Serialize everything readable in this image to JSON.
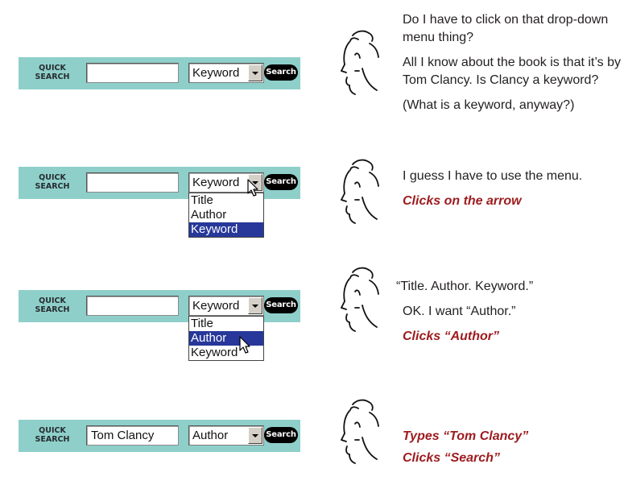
{
  "search_widget": {
    "label_line1": "QUICK",
    "label_line2": "SEARCH",
    "button_label": "Search"
  },
  "panels": [
    {
      "input_value": "",
      "select_value": "Keyword",
      "dropdown_open": false,
      "dialogue": [
        "Do I have to click on that drop-down menu thing?",
        "All I know about the book is that it’s by Tom Clancy. Is Clancy a keyword?",
        "(What is a keyword, anyway?)"
      ],
      "actions": []
    },
    {
      "input_value": "",
      "select_value": "Keyword",
      "dropdown_open": true,
      "options": [
        "Title",
        "Author",
        "Keyword"
      ],
      "highlighted_option": "Keyword",
      "dialogue": [
        "I guess I have to use the menu."
      ],
      "actions": [
        "Clicks on the arrow"
      ]
    },
    {
      "input_value": "",
      "select_value": "Keyword",
      "dropdown_open": true,
      "options": [
        "Title",
        "Author",
        "Keyword"
      ],
      "highlighted_option": "Author",
      "dialogue": [
        "“Title. Author. Keyword.”",
        "OK. I want “Author.”"
      ],
      "actions": [
        "Clicks “Author”"
      ]
    },
    {
      "input_value": "Tom Clancy",
      "select_value": "Author",
      "dropdown_open": false,
      "dialogue": [],
      "actions": [
        "Types “Tom Clancy”",
        "Clicks “Search”"
      ]
    }
  ]
}
